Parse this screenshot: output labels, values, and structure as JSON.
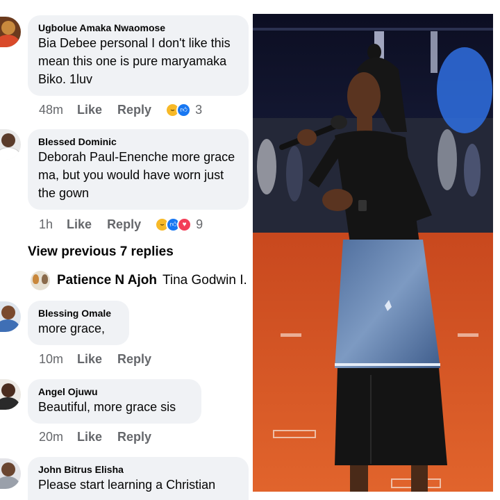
{
  "comments": [
    {
      "author": "Ugbolue Amaka Nwaomose",
      "lines": [
        "Bia Debee personal I don't like this",
        "mean this one is pure maryamaka",
        "Biko. 1luv"
      ],
      "time": "48m",
      "like": "Like",
      "reply": "Reply",
      "reactions": [
        "haha",
        "like"
      ],
      "count": "3"
    },
    {
      "author": "Blessed Dominic",
      "lines": [
        "Deborah Paul-Enenche more grace",
        "ma, but you would have worn just",
        "the gown"
      ],
      "time": "1h",
      "like": "Like",
      "reply": "Reply",
      "reactions": [
        "haha",
        "like",
        "love"
      ],
      "count": "9"
    },
    {
      "author": "Blessing Omale",
      "lines": [
        "more grace,"
      ],
      "time": "10m",
      "like": "Like",
      "reply": "Reply"
    },
    {
      "author": "Angel Ojuwu",
      "lines": [
        "Beautiful, more grace sis"
      ],
      "time": "20m",
      "like": "Like",
      "reply": "Reply"
    },
    {
      "author": "John Bitrus Elisha",
      "lines": [
        "Please start learning a Christian"
      ]
    }
  ],
  "view_previous": "View previous 7 replies",
  "collapsed_reply": {
    "name": "Patience N Ajoh",
    "preview": "Tina Godwin I."
  },
  "icons": {
    "haha": "haha-reaction-icon",
    "like": "like-reaction-icon",
    "love": "love-reaction-icon"
  },
  "colors": {
    "bubble": "#f0f2f5",
    "meta": "#65676b",
    "like_blue": "#1877f2",
    "love_red": "#f33e58",
    "haha_yellow": "#f7b928"
  }
}
